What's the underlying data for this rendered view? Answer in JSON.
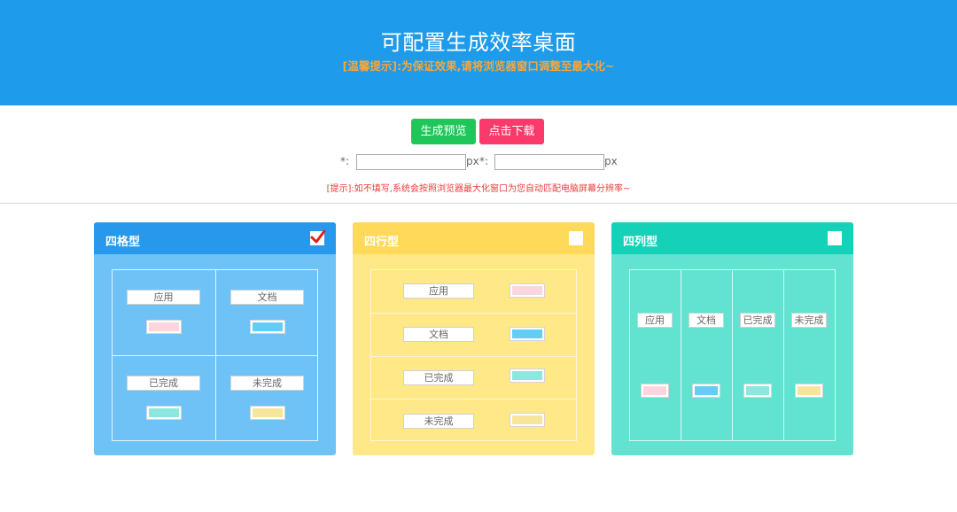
{
  "header": {
    "title": "可配置生成效率桌面",
    "subtitle": "[温馨提示]:为保证效果,请将浏览器窗口调整至最大化~"
  },
  "controls": {
    "preview_label": "生成预览",
    "download_label": "点击下载",
    "width_label": "*:",
    "height_label": "*:",
    "unit": "px",
    "width_value": "",
    "height_value": "",
    "tip": "[提示]:如不填写,系统会按照浏览器最大化窗口为您自动匹配电脑屏幕分辨率~"
  },
  "colors": {
    "header_bg": "#1e9bea",
    "subtitle": "#f7a63c",
    "preview_btn": "#1fc75a",
    "download_btn": "#fa3a6a",
    "tip": "#f23b3b",
    "app": "#fcd6de",
    "doc": "#63cdf6",
    "done": "#8ae8de",
    "todo": "#f8e59c"
  },
  "layouts": [
    {
      "name": "四格型",
      "checked": true,
      "items": [
        "应用",
        "文档",
        "已完成",
        "未完成"
      ]
    },
    {
      "name": "四行型",
      "checked": false,
      "items": [
        "应用",
        "文档",
        "已完成",
        "未完成"
      ]
    },
    {
      "name": "四列型",
      "checked": false,
      "items": [
        "应用",
        "文档",
        "已完成",
        "未完成"
      ]
    }
  ]
}
